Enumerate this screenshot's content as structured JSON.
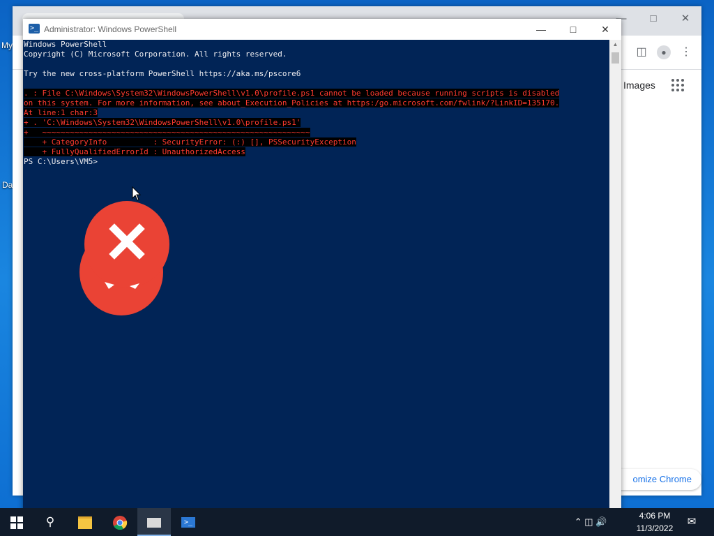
{
  "desktop": {
    "labels": [
      "My",
      "Da"
    ]
  },
  "chrome": {
    "images_link": "Images",
    "customize_button": "omize Chrome"
  },
  "powershell": {
    "title": "Administrator: Windows PowerShell",
    "lines": [
      {
        "text": "Windows PowerShell",
        "type": "normal"
      },
      {
        "text": "Copyright (C) Microsoft Corporation. All rights reserved.",
        "type": "normal"
      },
      {
        "text": "",
        "type": "normal"
      },
      {
        "text": "Try the new cross-platform PowerShell https://aka.ms/pscore6",
        "type": "normal"
      },
      {
        "text": "",
        "type": "normal"
      },
      {
        "text": ". : File C:\\Windows\\System32\\WindowsPowerShell\\v1.0\\profile.ps1 cannot be loaded because running scripts is disabled",
        "type": "error"
      },
      {
        "text": "on this system. For more information, see about_Execution_Policies at https:/go.microsoft.com/fwlink/?LinkID=135170.",
        "type": "error"
      },
      {
        "text": "At line:1 char:3",
        "type": "error"
      },
      {
        "text": "+ . 'C:\\Windows\\System32\\WindowsPowerShell\\v1.0\\profile.ps1'",
        "type": "error"
      },
      {
        "text": "+   ~~~~~~~~~~~~~~~~~~~~~~~~~~~~~~~~~~~~~~~~~~~~~~~~~~~~~~~~~~",
        "type": "error"
      },
      {
        "text": "    + CategoryInfo          : SecurityError: (:) [], PSSecurityException",
        "type": "error"
      },
      {
        "text": "    + FullyQualifiedErrorId : UnauthorizedAccess",
        "type": "error"
      },
      {
        "text": "PS C:\\Users\\VM5>",
        "type": "normal"
      }
    ]
  },
  "taskbar": {
    "time": "4:06 PM",
    "date": "11/3/2022"
  },
  "colors": {
    "console_bg": "#012456",
    "error_text": "#ff3b30",
    "bug_red": "#ea4335"
  }
}
